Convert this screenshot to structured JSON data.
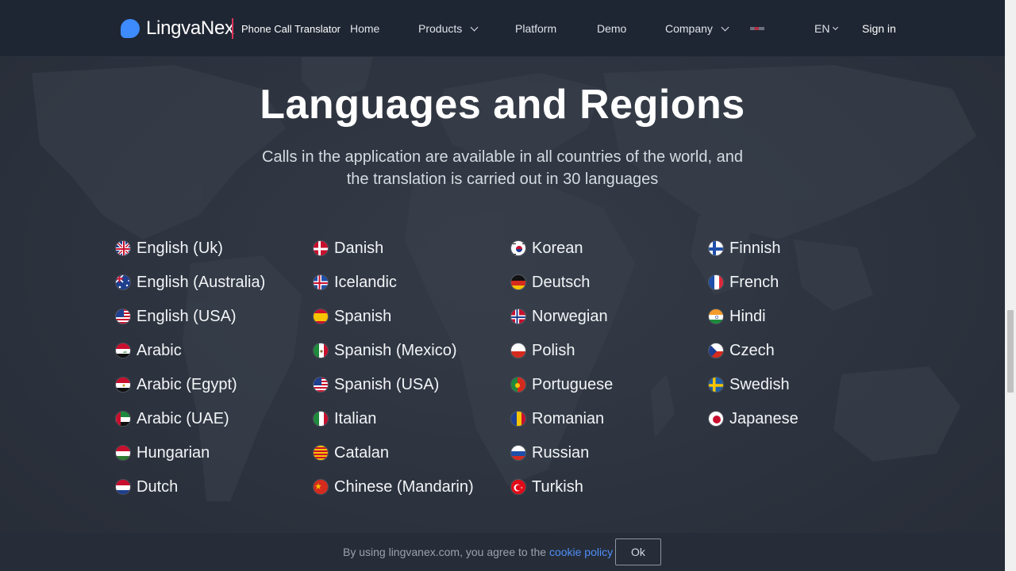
{
  "header": {
    "logo_text": "LingvaNex",
    "product_name": "Phone Call Translator",
    "nav": [
      {
        "label": "Home",
        "has_dropdown": false
      },
      {
        "label": "Products",
        "has_dropdown": true
      },
      {
        "label": "Platform",
        "has_dropdown": false
      },
      {
        "label": "Demo",
        "has_dropdown": false
      },
      {
        "label": "Company",
        "has_dropdown": true
      }
    ],
    "lang_selector": "EN",
    "signin_label": "Sign in"
  },
  "main": {
    "title": "Languages and Regions",
    "subtitle_line1": "Calls in the application are available in all countries of the world, and",
    "subtitle_line2": "the translation is carried out in 30 languages"
  },
  "languages": {
    "col1": [
      {
        "label": "English (Uk)",
        "flag": "uk-flag-icon"
      },
      {
        "label": "English (Australia)",
        "flag": "australia-flag-icon"
      },
      {
        "label": "English (USA)",
        "flag": "usa-flag-icon"
      },
      {
        "label": "Arabic",
        "flag": "iraq-flag-icon"
      },
      {
        "label": "Arabic (Egypt)",
        "flag": "egypt-flag-icon"
      },
      {
        "label": "Arabic (UAE)",
        "flag": "uae-flag-icon"
      },
      {
        "label": "Hungarian",
        "flag": "hungary-flag-icon"
      },
      {
        "label": "Dutch",
        "flag": "netherlands-flag-icon"
      }
    ],
    "col2": [
      {
        "label": "Danish",
        "flag": "denmark-flag-icon"
      },
      {
        "label": "Icelandic",
        "flag": "iceland-flag-icon"
      },
      {
        "label": "Spanish",
        "flag": "spain-flag-icon"
      },
      {
        "label": "Spanish (Mexico)",
        "flag": "mexico-flag-icon"
      },
      {
        "label": "Spanish (USA)",
        "flag": "usa-flag-icon"
      },
      {
        "label": "Italian",
        "flag": "italy-flag-icon"
      },
      {
        "label": "Catalan",
        "flag": "catalonia-flag-icon"
      },
      {
        "label": "Chinese (Mandarin)",
        "flag": "china-flag-icon"
      }
    ],
    "col3": [
      {
        "label": "Korean",
        "flag": "korea-flag-icon"
      },
      {
        "label": "Deutsch",
        "flag": "germany-flag-icon"
      },
      {
        "label": "Norwegian",
        "flag": "norway-flag-icon"
      },
      {
        "label": "Polish",
        "flag": "poland-flag-icon"
      },
      {
        "label": "Portuguese",
        "flag": "portugal-flag-icon"
      },
      {
        "label": "Romanian",
        "flag": "romania-flag-icon"
      },
      {
        "label": "Russian",
        "flag": "russia-flag-icon"
      },
      {
        "label": "Turkish",
        "flag": "turkey-flag-icon"
      }
    ],
    "col4": [
      {
        "label": "Finnish",
        "flag": "finland-flag-icon"
      },
      {
        "label": "French",
        "flag": "france-flag-icon"
      },
      {
        "label": "Hindi",
        "flag": "india-flag-icon"
      },
      {
        "label": "Czech",
        "flag": "czech-flag-icon"
      },
      {
        "label": "Swedish",
        "flag": "sweden-flag-icon"
      },
      {
        "label": "Japanese",
        "flag": "japan-flag-icon"
      }
    ]
  },
  "cookie": {
    "text": "By using lingvanex.com, you agree to the ",
    "link_label": "cookie policy",
    "ok_label": "Ok"
  },
  "colors": {
    "background": "#2d3440",
    "header": "#1f2633",
    "accent": "#3d8bfd",
    "divider": "#e0325a"
  }
}
